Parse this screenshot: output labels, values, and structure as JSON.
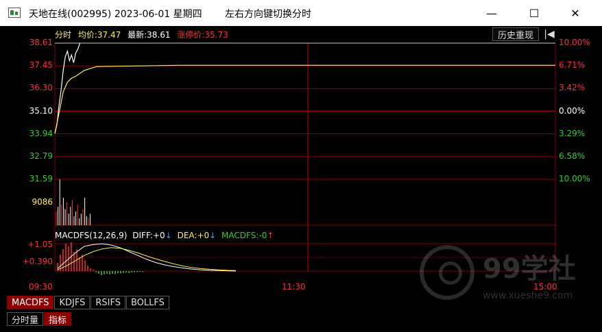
{
  "window": {
    "title": "天地在线(002995) 2023-06-01 星期四",
    "hint": "左右方向键切换分时",
    "minimize_glyph": "—",
    "maximize_glyph": "☐",
    "close_glyph": "✕"
  },
  "info": {
    "mode": "分时",
    "avg_label": "均价:",
    "avg_value": "37.47",
    "latest_label": "最新:",
    "latest_value": "38.61",
    "limit_label": "涨停价:",
    "limit_value": "35.73",
    "history_button": "历史重现",
    "back_glyph": "|◀"
  },
  "colors": {
    "up": "#ff3030",
    "down": "#33cc33",
    "neutral": "#dddddd",
    "grid": "#8b0000",
    "price_line": "#ffffff",
    "avg_line": "#ffee55",
    "accent_yellow": "#ffee55"
  },
  "macd": {
    "name": "MACDFS(12,26,9)",
    "diff_label": "DIFF:",
    "diff_value": "+0",
    "diff_arrow": "↓",
    "dea_label": "DEA:",
    "dea_value": "+0",
    "dea_arrow": "↓",
    "macdfs_label": "MACDFS:",
    "macdfs_value": "-0",
    "macdfs_arrow": "↑"
  },
  "tabs": {
    "indicators": [
      {
        "label": "MACDFS",
        "active": true
      },
      {
        "label": "KDJFS",
        "active": false
      },
      {
        "label": "RSIFS",
        "active": false
      },
      {
        "label": "BOLLFS",
        "active": false
      }
    ],
    "mode_tabs": [
      {
        "label": "分时量",
        "active": false
      },
      {
        "label": "指标",
        "active": true
      }
    ]
  },
  "watermark": {
    "text": "99学社",
    "url": "www.xueshe9.com"
  },
  "chart_data": {
    "type": "line",
    "price_axis_left": [
      "38.61",
      "37.45",
      "36.30",
      "35.10",
      "33.94",
      "32.79",
      "31.59"
    ],
    "price_axis_right": [
      "10.00%",
      "6.71%",
      "3.42%",
      "0.00%",
      "3.29%",
      "6.58%",
      "10.00%"
    ],
    "volume_axis": [
      "9086"
    ],
    "macd_axis": [
      "+1.05",
      "+0.390"
    ],
    "time_axis": [
      "09:30",
      "11:30",
      "15:00"
    ],
    "series": [
      {
        "name": "分时",
        "x": [
          0,
          1,
          2,
          3,
          4,
          5,
          6,
          7,
          8,
          9,
          10,
          11,
          12
        ],
        "values": [
          33.95,
          34.4,
          35.4,
          36.2,
          37.2,
          37.9,
          38.2,
          37.7,
          38.0,
          37.6,
          38.1,
          38.3,
          38.61
        ]
      },
      {
        "name": "均价",
        "x": [
          0,
          2,
          4,
          6,
          8,
          10,
          14,
          20,
          60,
          240
        ],
        "values": [
          33.95,
          35.0,
          36.1,
          36.6,
          36.8,
          36.9,
          37.2,
          37.4,
          37.47,
          37.47
        ]
      }
    ],
    "volume": [
      30,
      40,
      100,
      45,
      60,
      35,
      50,
      25,
      40,
      55,
      20,
      30,
      45,
      15,
      25,
      35,
      60,
      20,
      15,
      25
    ],
    "macd_hist": [
      0.3,
      0.6,
      0.8,
      1.0,
      0.9,
      1.05,
      0.7,
      0.8,
      0.5,
      0.6,
      0.4,
      0.2,
      0.1,
      0.05,
      -0.05,
      -0.1,
      -0.15,
      -0.12,
      -0.1,
      -0.12,
      -0.1,
      -0.11,
      -0.08,
      -0.09,
      -0.07,
      -0.06,
      -0.07,
      -0.05,
      -0.05,
      -0.04,
      -0.03,
      -0.03
    ],
    "macd_diff": [
      0.1,
      0.4,
      0.7,
      0.95,
      1.02,
      1.05,
      1.0,
      0.9,
      0.75,
      0.6,
      0.45,
      0.33,
      0.24,
      0.17,
      0.12,
      0.08,
      0.05,
      0.03,
      0.02,
      0.01,
      0.0
    ],
    "macd_dea": [
      0.05,
      0.2,
      0.4,
      0.6,
      0.75,
      0.85,
      0.9,
      0.88,
      0.8,
      0.7,
      0.58,
      0.47,
      0.37,
      0.28,
      0.2,
      0.14,
      0.1,
      0.07,
      0.05,
      0.03,
      0.02
    ]
  }
}
